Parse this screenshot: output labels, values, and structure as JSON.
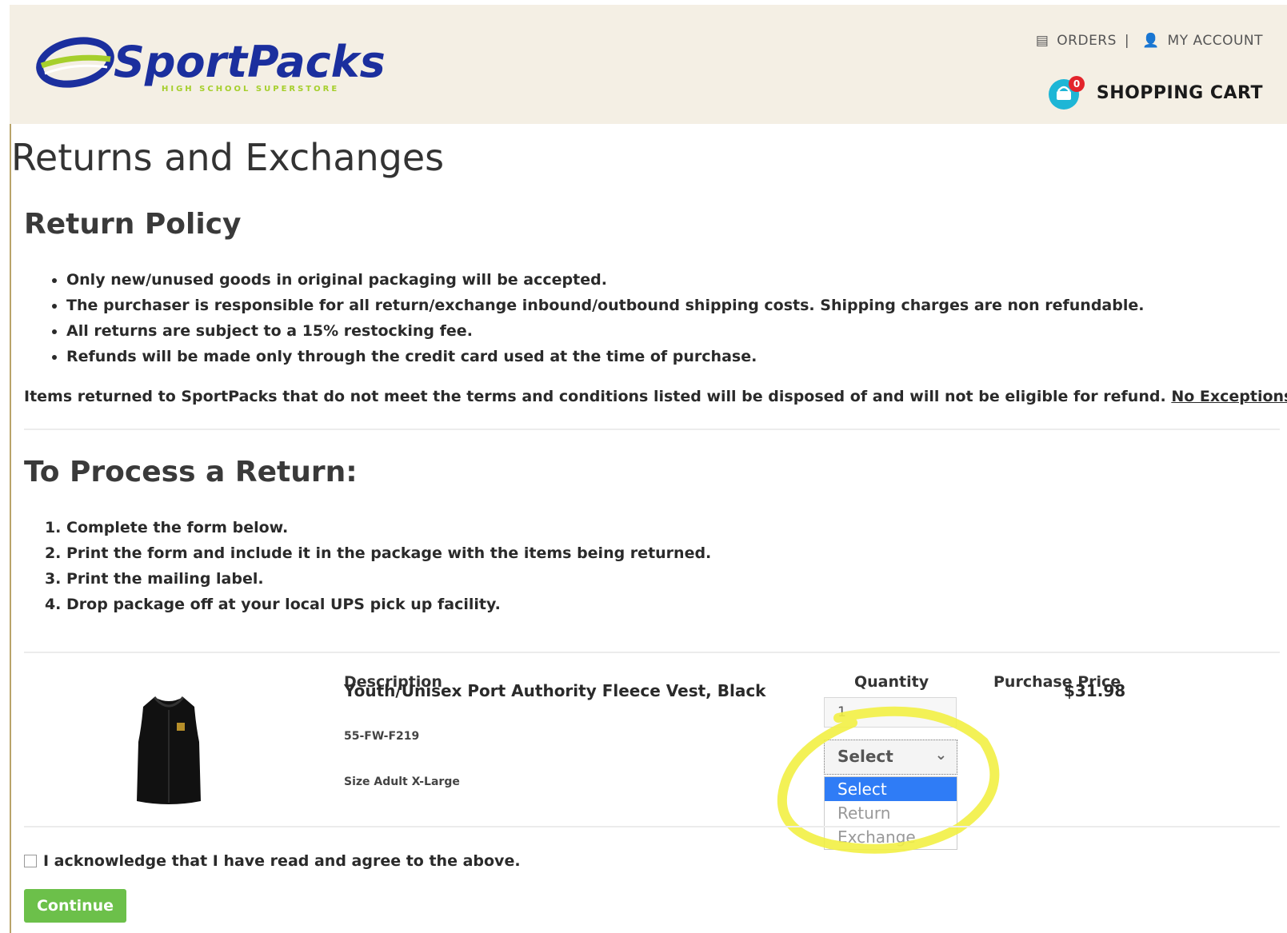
{
  "header": {
    "logo_text": "SportPacks",
    "logo_tagline": "HIGH SCHOOL SUPERSTORE",
    "orders_label": "ORDERS",
    "separator": "|",
    "account_label": "MY ACCOUNT",
    "cart_label": "SHOPPING CART",
    "cart_count": "0"
  },
  "page": {
    "title": "Returns and Exchanges",
    "policy_heading": "Return Policy",
    "policy_items": [
      "Only new/unused goods in original packaging will be accepted.",
      "The purchaser is responsible for all return/exchange inbound/outbound shipping costs. Shipping charges are non refundable.",
      "All returns are subject to a 15% restocking fee.",
      "Refunds will be made only through the credit card used at the time of purchase."
    ],
    "notice_text": "Items returned to SportPacks that do not meet the terms and conditions listed will be disposed of and will not be eligible for refund.",
    "notice_link": "No Exceptions.",
    "process_heading": "To Process a Return:",
    "steps": [
      "Complete the form below.",
      "Print the form and include it in the package with the items being returned.",
      "Print the mailing label.",
      "Drop package off at your local UPS pick up facility."
    ]
  },
  "table": {
    "col_description": "Description",
    "col_quantity": "Quantity",
    "col_price": "Purchase Price",
    "item": {
      "name": "Youth/Unisex Port Authority Fleece Vest, Black",
      "sku": "55-FW-F219",
      "size": "Size Adult X-Large",
      "quantity": "1",
      "price": "$31.98",
      "select_value": "Select",
      "options": [
        "Select",
        "Return",
        "Exchange"
      ]
    }
  },
  "form": {
    "ack_label": "I acknowledge that I have read and agree to the above.",
    "continue_label": "Continue"
  },
  "colors": {
    "header_bg": "#f4efe4",
    "logo_blue": "#1b2f9e",
    "logo_green": "#a6cf2c",
    "cart_teal": "#1eb6d6",
    "badge_red": "#e3242b",
    "continue_green": "#6cc04a",
    "option_selected": "#2f7cf6",
    "highlight_yellow": "#f2f044"
  },
  "icons": [
    "orders-icon",
    "account-icon",
    "cart-icon",
    "chevron-down-icon"
  ]
}
